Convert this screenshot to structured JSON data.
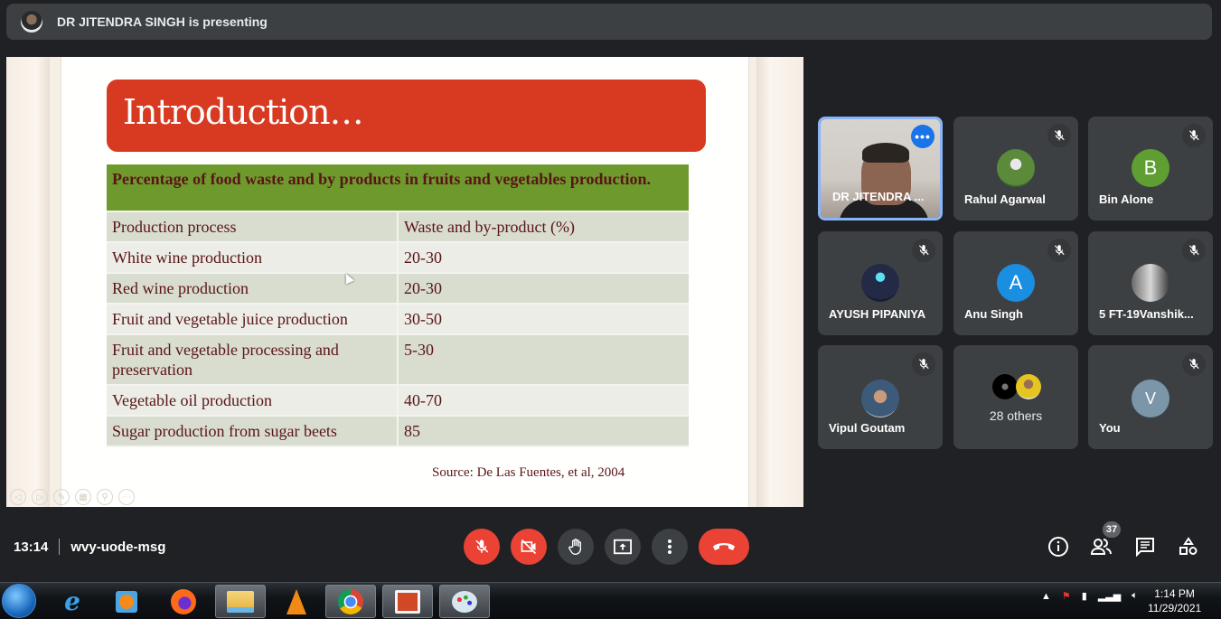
{
  "banner": {
    "presenter_text": "DR JITENDRA SINGH is presenting"
  },
  "slide": {
    "title": "Introduction…",
    "table_caption": "Percentage of food waste and by products in fruits and vegetables production.",
    "headers": [
      "Production process",
      "Waste and by-product (%)"
    ],
    "rows": [
      {
        "process": "White wine production",
        "waste": "20-30"
      },
      {
        "process": "Red wine production",
        "waste": "20-30"
      },
      {
        "process": "Fruit and vegetable juice production",
        "waste": "30-50"
      },
      {
        "process": "Fruit and vegetable processing and preservation",
        "waste": "5-30"
      },
      {
        "process": "Vegetable oil production",
        "waste": "40-70"
      },
      {
        "process": "Sugar production from sugar beets",
        "waste": "85"
      }
    ],
    "source": "Source: De Las Fuentes, et al, 2004",
    "controls": [
      "previous-icon",
      "next-icon",
      "pen-icon",
      "slides-icon",
      "zoom-icon",
      "more-icon"
    ]
  },
  "participants": [
    {
      "name": "DR JITENDRA ...",
      "type": "video",
      "active": true
    },
    {
      "name": "Rahul Agarwal",
      "type": "photo",
      "muted": true
    },
    {
      "name": "Bin Alone",
      "type": "initial",
      "initial": "B",
      "color": "#5f9e32",
      "muted": true
    },
    {
      "name": "AYUSH PIPANIYA",
      "type": "photo",
      "muted": true
    },
    {
      "name": "Anu Singh",
      "type": "initial",
      "initial": "A",
      "color": "#1a8ee0",
      "muted": true
    },
    {
      "name": "5 FT-19Vanshik...",
      "type": "photo",
      "muted": true
    },
    {
      "name": "Vipul Goutam",
      "type": "photo",
      "muted": true
    },
    {
      "name": "28 others",
      "type": "group"
    },
    {
      "name": "You",
      "type": "initial",
      "initial": "V",
      "color": "#7a96a8",
      "muted": true
    }
  ],
  "meeting": {
    "time": "13:14",
    "code": "wvy-uode-msg",
    "participant_count": "37"
  },
  "controls": {
    "mic": "mic-off-icon",
    "camera": "camera-off-icon",
    "raise_hand": "hand-icon",
    "present": "present-icon",
    "more": "more-vert-icon",
    "leave": "hangup-icon"
  },
  "right_controls": [
    "info-icon",
    "people-icon",
    "chat-icon",
    "activities-icon"
  ],
  "taskbar": {
    "apps": [
      "Internet Explorer",
      "Windows Media Player",
      "Firefox",
      "File Explorer",
      "VLC",
      "Chrome",
      "PowerPoint",
      "Paint"
    ],
    "time": "1:14 PM",
    "date": "11/29/2021"
  }
}
